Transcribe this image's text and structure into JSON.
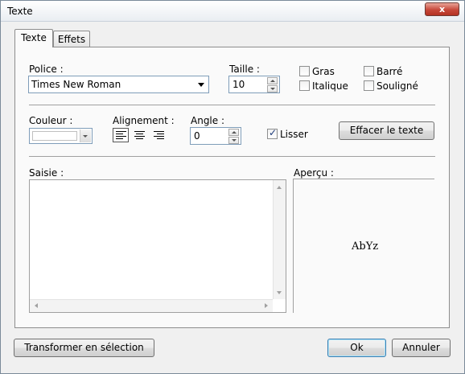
{
  "window": {
    "title": "Texte",
    "close_glyph": "x"
  },
  "tabs": [
    {
      "label": "Texte",
      "active": true
    },
    {
      "label": "Effets",
      "active": false
    }
  ],
  "font": {
    "label": "Police :",
    "selected": "Times New Roman"
  },
  "size": {
    "label": "Taille :",
    "value": "10"
  },
  "styles": {
    "bold": {
      "label": "Gras",
      "checked": false
    },
    "strike": {
      "label": "Barré",
      "checked": false
    },
    "italic": {
      "label": "Italique",
      "checked": false
    },
    "underline": {
      "label": "Souligné",
      "checked": false
    }
  },
  "color": {
    "label": "Couleur :",
    "value_hex": "#ffffff"
  },
  "alignment": {
    "label": "Alignement :",
    "options": [
      "align-left-icon",
      "align-center-icon",
      "align-right-icon"
    ],
    "selected": "align-left-icon"
  },
  "angle": {
    "label": "Angle :",
    "value": "0"
  },
  "smooth": {
    "label": "Lisser",
    "checked": true
  },
  "clear_button": {
    "label": "Effacer le texte"
  },
  "input": {
    "label": "Saisie :",
    "value": ""
  },
  "preview": {
    "label": "Aperçu :",
    "sample": "AbYz"
  },
  "footer": {
    "transform_label": "Transformer en sélection",
    "ok_label": "Ok",
    "cancel_label": "Annuler"
  }
}
